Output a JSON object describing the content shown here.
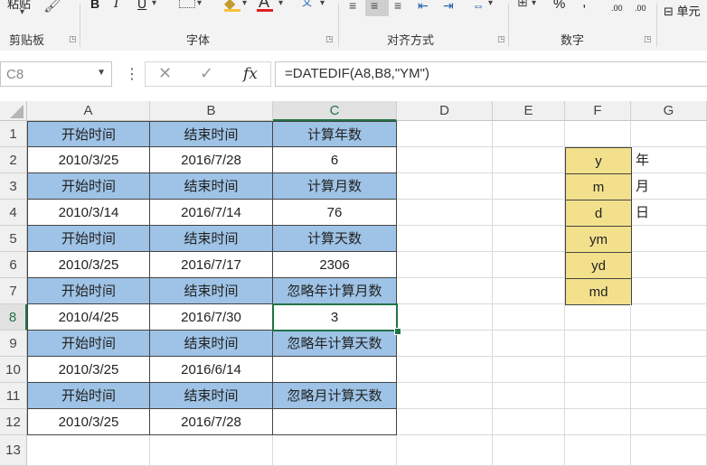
{
  "ribbon": {
    "paste_label": "粘贴",
    "bold": "B",
    "italic": "I",
    "underline": "U",
    "wen": "文",
    "percent": "%",
    "comma": ",",
    "dec_inc": ".00",
    "dec_dec": ".00",
    "cell_label": "单元",
    "groups": {
      "clipboard": "剪贴板",
      "font": "字体",
      "alignment": "对齐方式",
      "number": "数字"
    }
  },
  "namebox": {
    "value": "C8"
  },
  "formula_bar": {
    "cancel": "✕",
    "enter": "✓",
    "fx": "fx",
    "formula": "=DATEDIF(A8,B8,\"YM\")"
  },
  "columns": [
    "A",
    "B",
    "C",
    "D",
    "E",
    "F",
    "G"
  ],
  "rows": [
    "1",
    "2",
    "3",
    "4",
    "5",
    "6",
    "7",
    "8",
    "9",
    "10",
    "11",
    "12",
    "13"
  ],
  "table": [
    [
      "开始时间",
      "结束时间",
      "计算年数"
    ],
    [
      "2010/3/25",
      "2016/7/28",
      "6"
    ],
    [
      "开始时间",
      "结束时间",
      "计算月数"
    ],
    [
      "2010/3/14",
      "2016/7/14",
      "76"
    ],
    [
      "开始时间",
      "结束时间",
      "计算天数"
    ],
    [
      "2010/3/25",
      "2016/7/17",
      "2306"
    ],
    [
      "开始时间",
      "结束时间",
      "忽略年计算月数"
    ],
    [
      "2010/4/25",
      "2016/7/30",
      "3"
    ],
    [
      "开始时间",
      "结束时间",
      "忽略年计算天数"
    ],
    [
      "2010/3/25",
      "2016/6/14",
      ""
    ],
    [
      "开始时间",
      "结束时间",
      "忽略月计算天数"
    ],
    [
      "2010/3/25",
      "2016/7/28",
      ""
    ]
  ],
  "codes": [
    {
      "code": "y",
      "meaning": "年"
    },
    {
      "code": "m",
      "meaning": "月"
    },
    {
      "code": "d",
      "meaning": "日"
    },
    {
      "code": "ym",
      "meaning": ""
    },
    {
      "code": "yd",
      "meaning": ""
    },
    {
      "code": "md",
      "meaning": ""
    }
  ],
  "colors": {
    "header_fill": "#9ec3e6",
    "code_fill": "#f2e08c",
    "selection": "#217346"
  }
}
